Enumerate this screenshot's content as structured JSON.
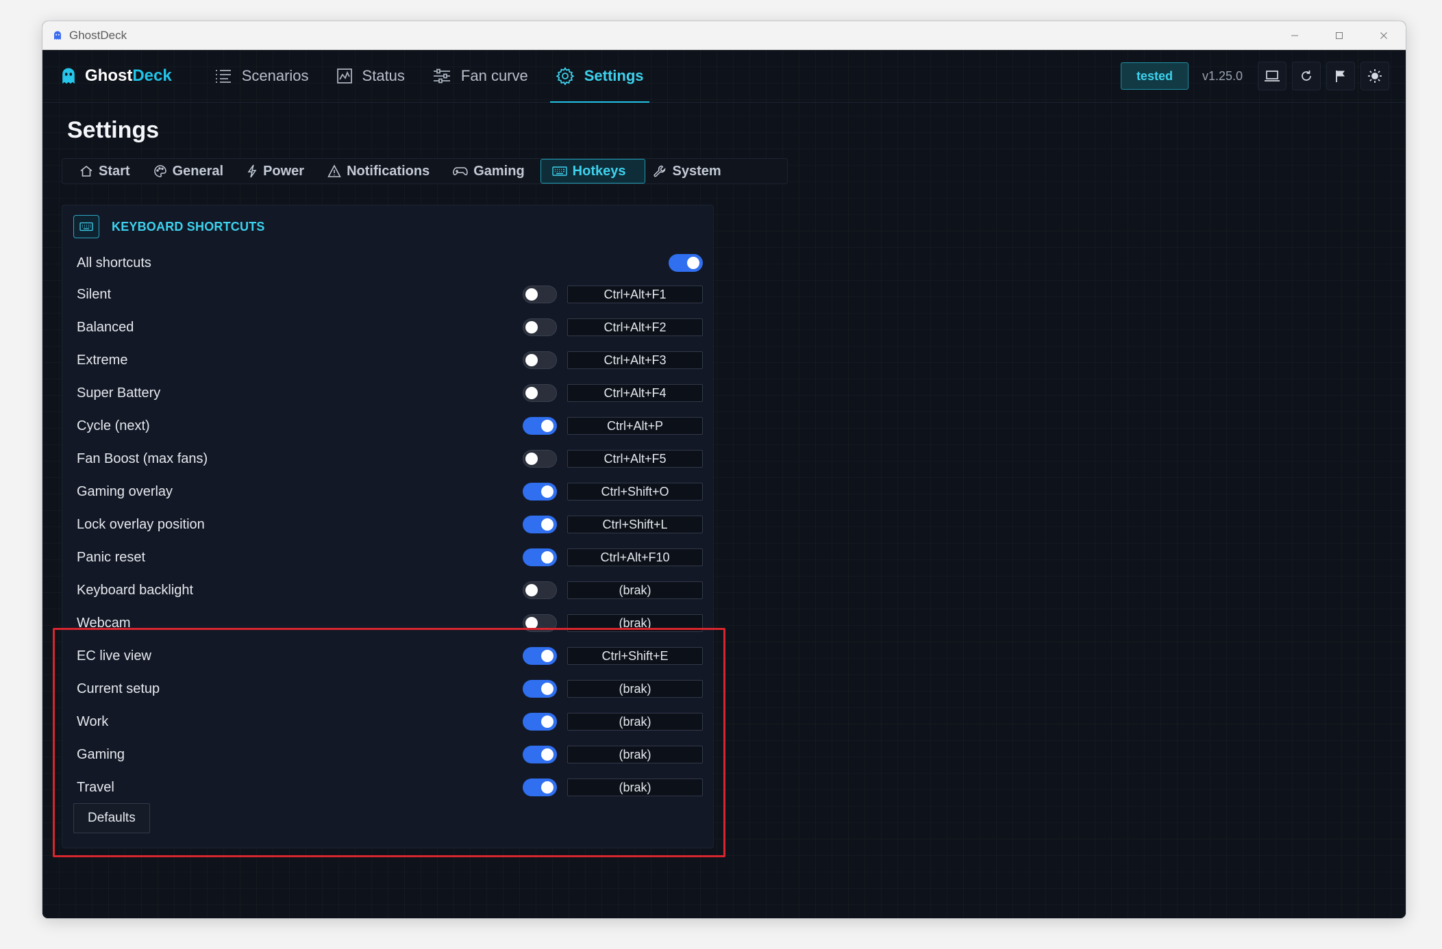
{
  "window": {
    "title": "GhostDeck"
  },
  "nav": {
    "brand_part1": "Ghost",
    "brand_part2": "Deck",
    "items": [
      {
        "label": "Scenarios",
        "icon": "list-icon"
      },
      {
        "label": "Status",
        "icon": "chart-icon"
      },
      {
        "label": "Fan curve",
        "icon": "sliders-icon"
      },
      {
        "label": "Settings",
        "icon": "gear-icon",
        "active": true
      }
    ],
    "badge": "tested",
    "version": "v1.25.0"
  },
  "page": {
    "title": "Settings",
    "tabs": [
      {
        "label": "Start",
        "icon": "home-icon"
      },
      {
        "label": "General",
        "icon": "palette-icon"
      },
      {
        "label": "Power",
        "icon": "bolt-icon"
      },
      {
        "label": "Notifications",
        "icon": "warning-icon"
      },
      {
        "label": "Gaming",
        "icon": "gamepad-icon"
      },
      {
        "label": "Hotkeys",
        "icon": "keyboard-icon",
        "active": true
      },
      {
        "label": "System",
        "icon": "wrench-icon"
      }
    ]
  },
  "shortcuts": {
    "title": "KEYBOARD SHORTCUTS",
    "all_label": "All shortcuts",
    "all_enabled": true,
    "rows": [
      {
        "label": "Silent",
        "enabled": false,
        "hotkey": "Ctrl+Alt+F1"
      },
      {
        "label": "Balanced",
        "enabled": false,
        "hotkey": "Ctrl+Alt+F2"
      },
      {
        "label": "Extreme",
        "enabled": false,
        "hotkey": "Ctrl+Alt+F3"
      },
      {
        "label": "Super Battery",
        "enabled": false,
        "hotkey": "Ctrl+Alt+F4"
      },
      {
        "label": "Cycle (next)",
        "enabled": true,
        "hotkey": "Ctrl+Alt+P"
      },
      {
        "label": "Fan Boost (max fans)",
        "enabled": false,
        "hotkey": "Ctrl+Alt+F5"
      },
      {
        "label": "Gaming overlay",
        "enabled": true,
        "hotkey": "Ctrl+Shift+O"
      },
      {
        "label": "Lock overlay position",
        "enabled": true,
        "hotkey": "Ctrl+Shift+L"
      },
      {
        "label": "Panic reset",
        "enabled": true,
        "hotkey": "Ctrl+Alt+F10"
      },
      {
        "label": "Keyboard backlight",
        "enabled": false,
        "hotkey": "(brak)"
      },
      {
        "label": "Webcam",
        "enabled": false,
        "hotkey": "(brak)"
      },
      {
        "label": "EC live view",
        "enabled": true,
        "hotkey": "Ctrl+Shift+E"
      },
      {
        "label": "Current setup",
        "enabled": true,
        "hotkey": "(brak)"
      },
      {
        "label": "Work",
        "enabled": true,
        "hotkey": "(brak)"
      },
      {
        "label": "Gaming",
        "enabled": true,
        "hotkey": "(brak)"
      },
      {
        "label": "Travel",
        "enabled": true,
        "hotkey": "(brak)"
      }
    ],
    "defaults_label": "Defaults"
  },
  "colors": {
    "accent": "#22c4e8",
    "toggle_on": "#2f6ff0",
    "highlight": "#d9262e",
    "background": "#0e121a"
  }
}
